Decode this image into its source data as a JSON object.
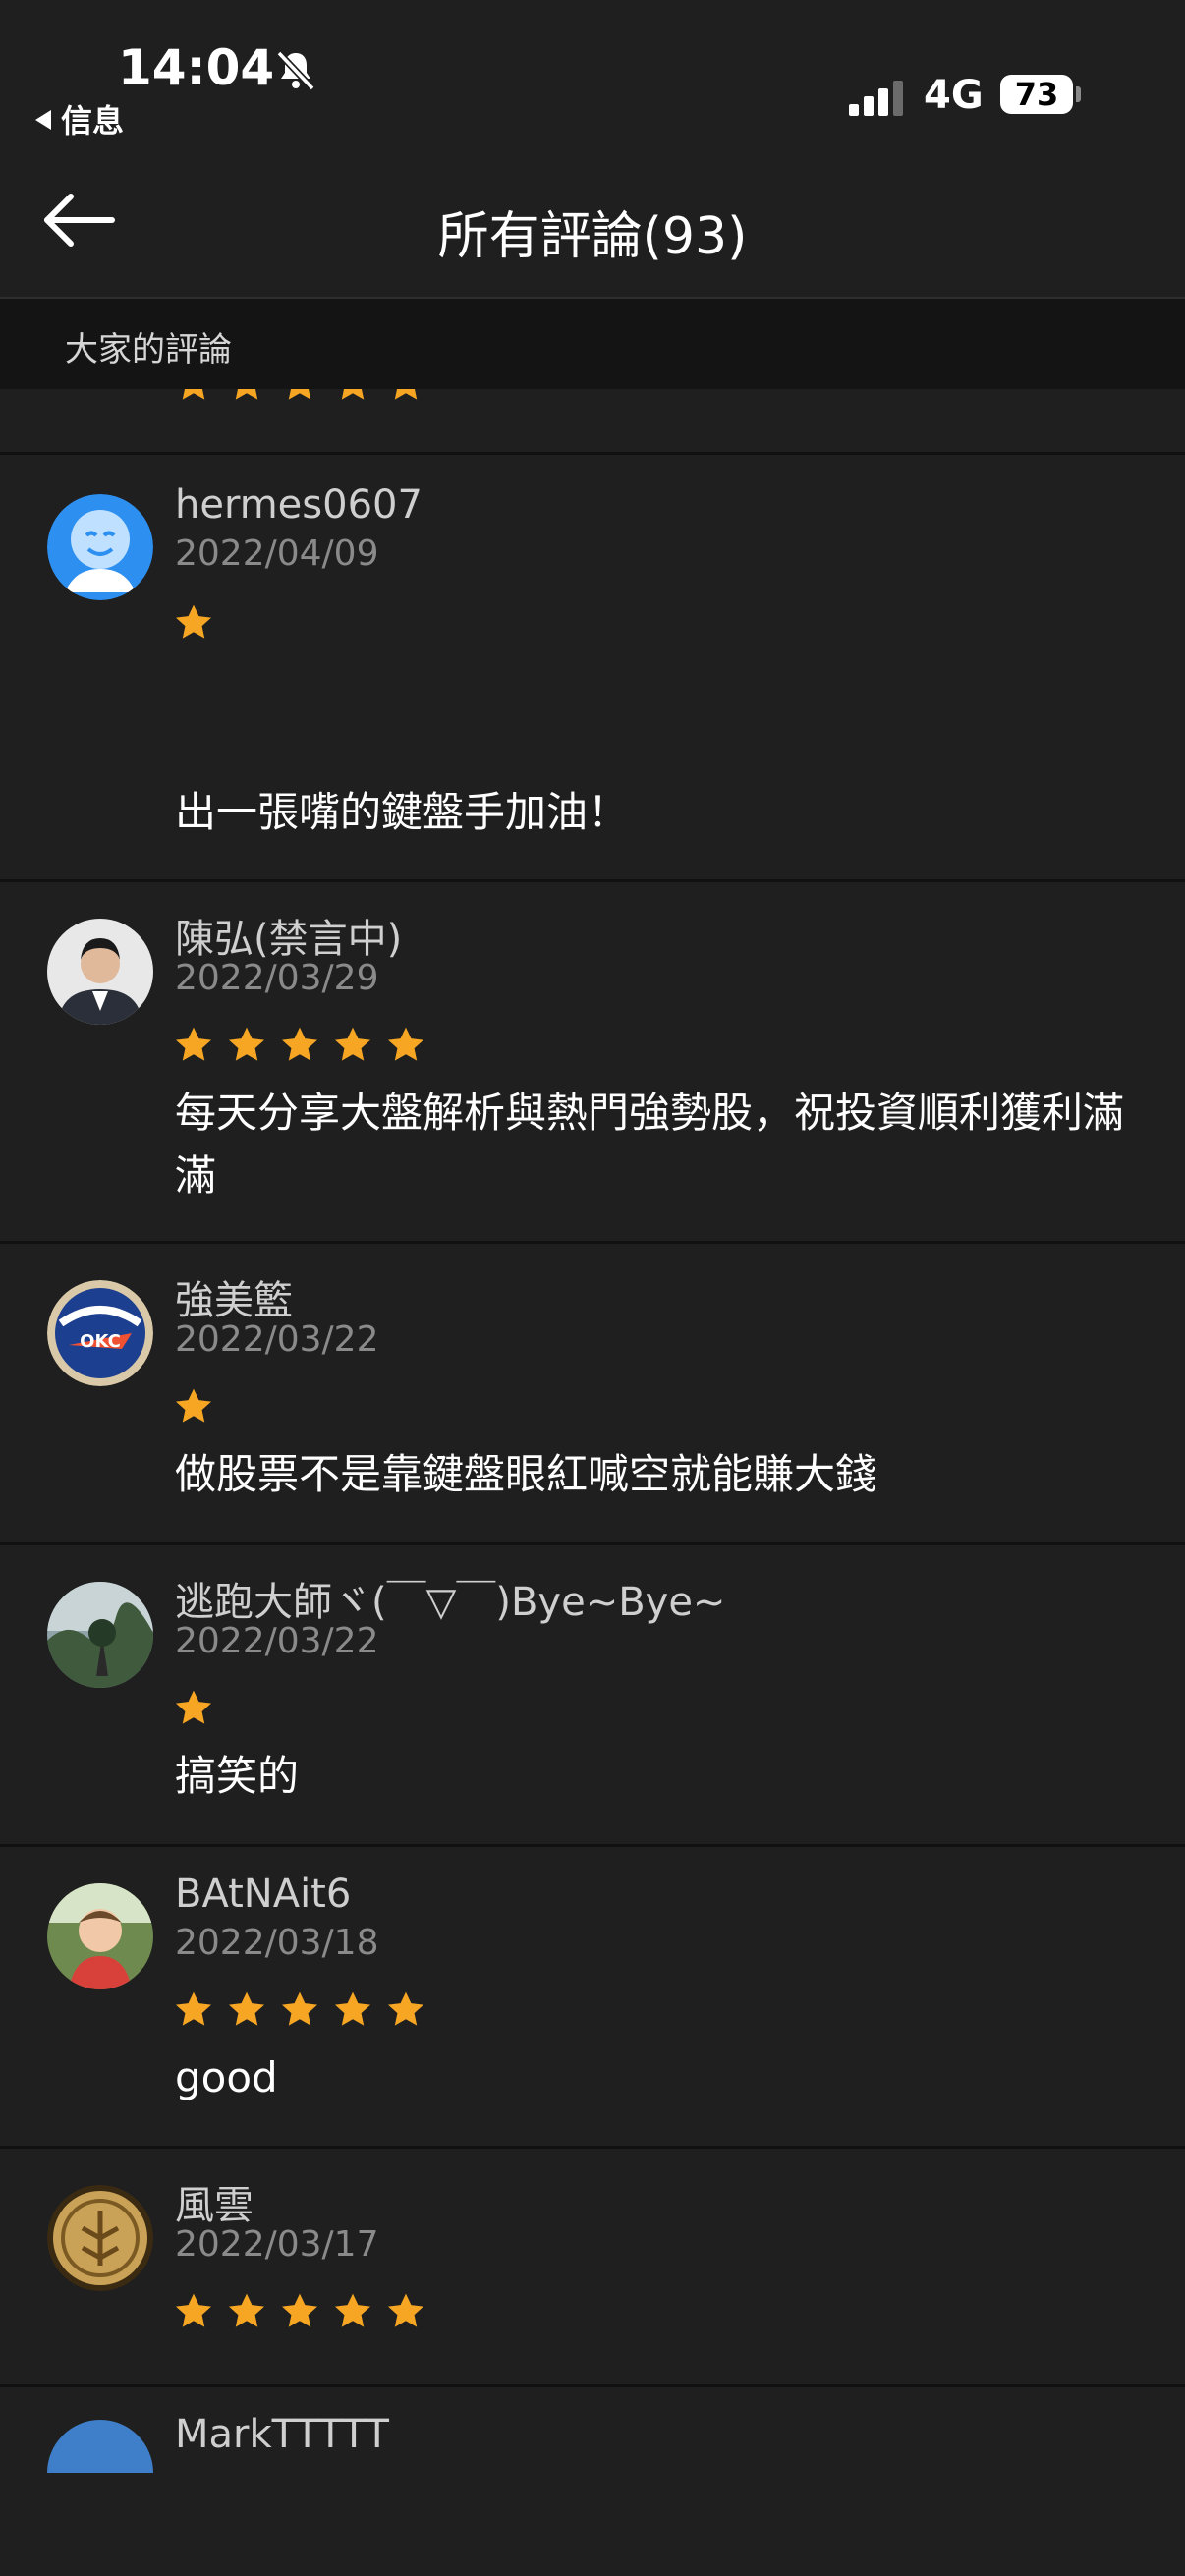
{
  "status_bar": {
    "time": "14:04",
    "back_app": "信息",
    "network": "4G",
    "battery": "73"
  },
  "header": {
    "title": "所有評論(93)"
  },
  "section": {
    "label": "大家的評論"
  },
  "colors": {
    "background": "#1f1f1f",
    "star": "#f6a623",
    "section_bar": "#141414"
  },
  "reviews": [
    {
      "name": "hermes0607",
      "date": "2022/04/09",
      "rating": 1,
      "comment": "出一張嘴的鍵盤手加油！",
      "avatar": "smiley-face-avatar"
    },
    {
      "name": "陳弘(禁言中)",
      "date": "2022/03/29",
      "rating": 5,
      "comment": "每天分享大盤解析與熱門強勢股，祝投資順利獲利滿滿",
      "avatar": "man-in-suit-avatar"
    },
    {
      "name": "強美籃",
      "date": "2022/03/22",
      "rating": 1,
      "comment": "做股票不是靠鍵盤眼紅喊空就能賺大錢",
      "avatar": "thunder-okc-logo-avatar"
    },
    {
      "name": "逃跑大師ヾ(￣▽￣)Bye~Bye~",
      "date": "2022/03/22",
      "rating": 1,
      "comment": "搞笑的",
      "avatar": "nature-photo-avatar"
    },
    {
      "name": "BAtNAit6",
      "date": "2022/03/18",
      "rating": 5,
      "comment": "good",
      "avatar": "child-photo-avatar"
    },
    {
      "name": "風雲",
      "date": "2022/03/17",
      "rating": 5,
      "comment": "",
      "avatar": "gold-coin-avatar"
    },
    {
      "name": "MarkTTTTT",
      "date": "",
      "rating": 0,
      "comment": "",
      "avatar": "sky-photo-avatar"
    }
  ]
}
